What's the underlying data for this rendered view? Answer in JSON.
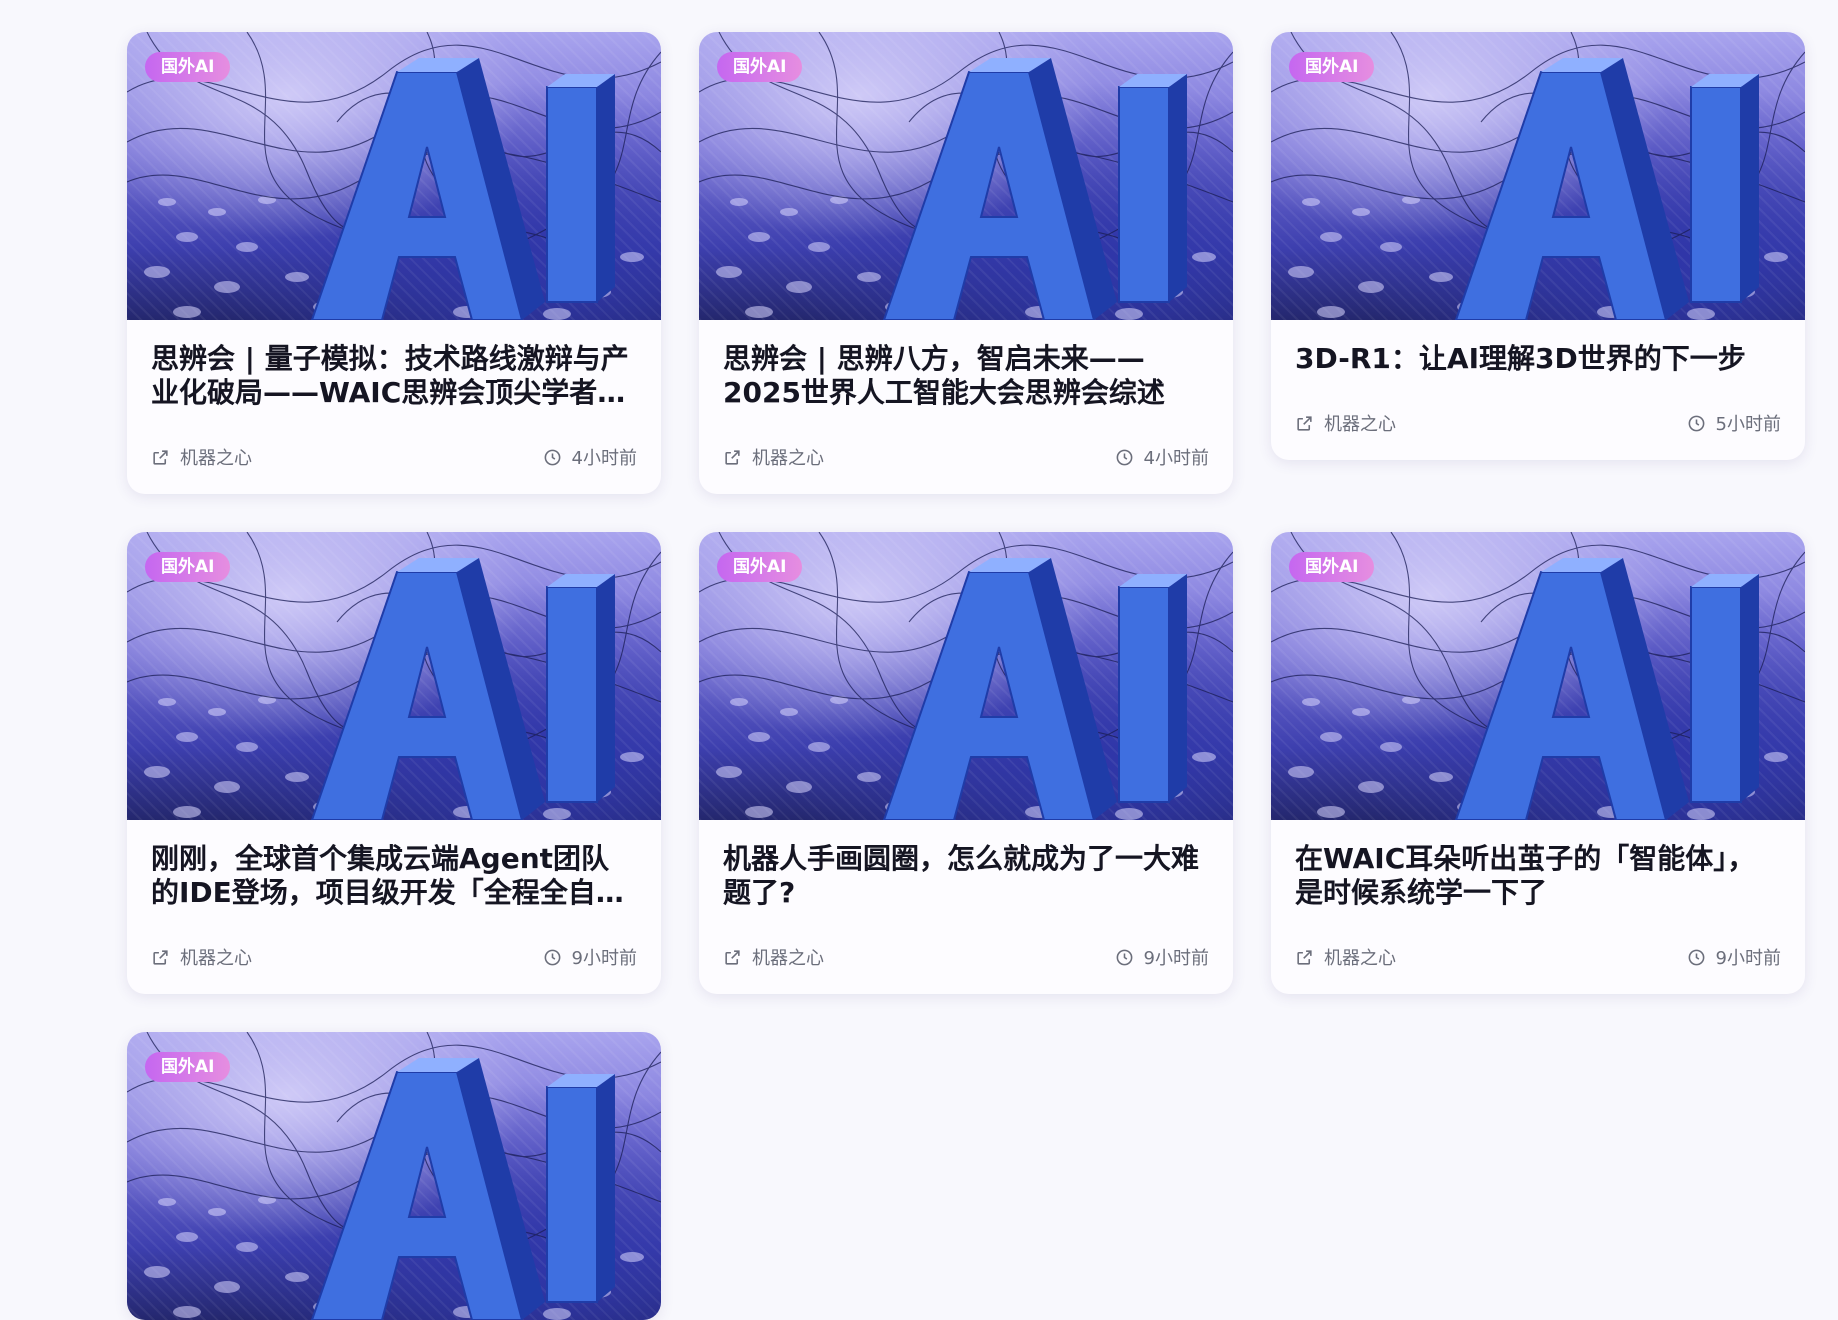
{
  "cards": [
    {
      "tag": "国外AI",
      "title": "思辨会 | 量子模拟：技术路线激辩与产业化破局——WAIC思辨会顶尖学者共议…",
      "source": "机器之心",
      "time": "4小时前"
    },
    {
      "tag": "国外AI",
      "title": "思辨会 | 思辨八方，智启未来——2025世界人工智能大会思辨会综述",
      "source": "机器之心",
      "time": "4小时前"
    },
    {
      "tag": "国外AI",
      "title": "3D-R1：让AI理解3D世界的下一步",
      "source": "机器之心",
      "time": "5小时前"
    },
    {
      "tag": "国外AI",
      "title": "刚刚，全球首个集成云端Agent团队的IDE登场，项目级开发「全程全自动」",
      "source": "机器之心",
      "time": "9小时前"
    },
    {
      "tag": "国外AI",
      "title": "机器人手画圆圈，怎么就成为了一大难题了?",
      "source": "机器之心",
      "time": "9小时前"
    },
    {
      "tag": "国外AI",
      "title": "在WAIC耳朵听出茧子的「智能体」，是时候系统学一下了",
      "source": "机器之心",
      "time": "9小时前"
    },
    {
      "tag": "国外AI"
    }
  ],
  "icons": {
    "source": "external-link-icon",
    "time": "clock-icon",
    "thumbnail": "ai-letters-image"
  },
  "colors": {
    "tag_gradient": [
      "#c567f0",
      "#e68ee0"
    ],
    "title": "#151522",
    "meta": "#6b6e7b",
    "background": "#f8f8fd"
  }
}
